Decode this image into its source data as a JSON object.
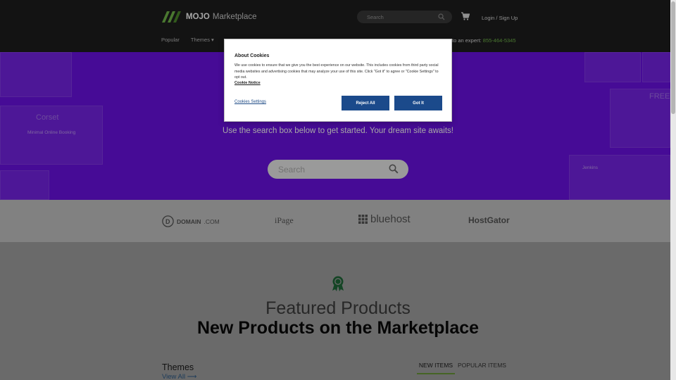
{
  "header": {
    "logo_bold": "MOJO",
    "logo_light": "Marketplace",
    "search_placeholder": "Search",
    "login": "Login / Sign Up"
  },
  "nav": {
    "items": [
      "Popular",
      "Themes ▾"
    ],
    "expert_text": "to an expert:",
    "expert_phone": "855-464-5345"
  },
  "hero": {
    "subtitle": "Use the search box below to get started. Your dream site awaits!",
    "search_placeholder": "Search",
    "tile_text_1": "Corset",
    "tile_text_2": "Minimal Online Booking",
    "tile_text_3": "FREE",
    "tile_text_4": "Jenkins"
  },
  "cookie": {
    "title": "About Cookies",
    "body": "We use cookies to ensure that we give you the best experience on our website. This includes cookies from third party social media websites and advertising cookies that may analyze your use of this site. Click \"Got it\" to agree or \"Cookie Settings\" to opt out.",
    "notice_link": "Cookie Notice",
    "settings_link": "Cookies Settings",
    "reject_label": "Reject All",
    "accept_label": "Got It"
  },
  "partners": {
    "domain_bold": "DOMAIN",
    "domain_light": ".COM",
    "ipage": "iPage",
    "bluehost": "bluehost",
    "hostgator": "HostGator"
  },
  "featured": {
    "title": "Featured Products",
    "subtitle": "New Products on the Marketplace",
    "themes_heading": "Themes",
    "view_all": "View All ⟶",
    "tab_new": "NEW ITEMS",
    "tab_popular": "POPULAR ITEMS"
  },
  "colors": {
    "header_bg": "#1e1e1e",
    "hero_purple": "#6c12e6",
    "accent_green": "#72b84a",
    "button_blue": "#1b4a8b"
  }
}
